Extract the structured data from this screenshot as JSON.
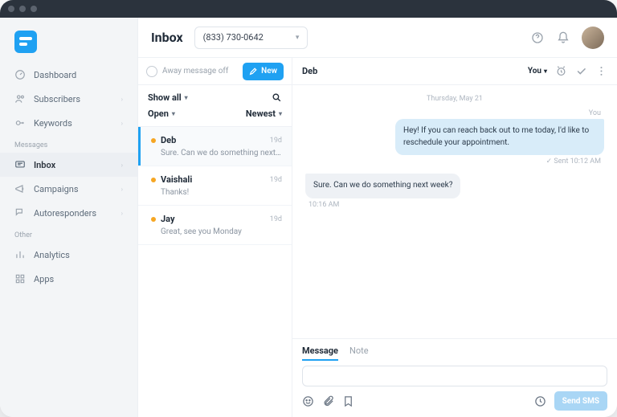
{
  "header": {
    "page_title": "Inbox",
    "phone_selected": "(833) 730-0642"
  },
  "sidebar": {
    "items": [
      {
        "label": "Dashboard"
      },
      {
        "label": "Subscribers"
      },
      {
        "label": "Keywords"
      }
    ],
    "group_messages_label": "Messages",
    "messages_items": [
      {
        "label": "Inbox"
      },
      {
        "label": "Campaigns"
      },
      {
        "label": "Autoresponders"
      }
    ],
    "group_other_label": "Other",
    "other_items": [
      {
        "label": "Analytics"
      },
      {
        "label": "Apps"
      }
    ]
  },
  "list_pane": {
    "away_label": "Away message off",
    "new_label": "New",
    "filter_show": "Show all",
    "filter_status": "Open",
    "filter_sort": "Newest"
  },
  "conversations": [
    {
      "name": "Deb",
      "time": "19d",
      "preview": "Sure. Can we do something next…"
    },
    {
      "name": "Vaishali",
      "time": "19d",
      "preview": "Thanks!"
    },
    {
      "name": "Jay",
      "time": "19d",
      "preview": "Great, see you Monday"
    }
  ],
  "conv": {
    "title": "Deb",
    "assigned_label": "You",
    "date_separator": "Thursday, May 21",
    "sender_you": "You",
    "msg_out": "Hey! If you can reach back out to me today, I'd like to reschedule your appointment.",
    "sent_stamp": "Sent 10:12 AM",
    "msg_in": "Sure. Can we do something next week?",
    "in_stamp": "10:16 AM"
  },
  "composer": {
    "tab_message": "Message",
    "tab_note": "Note",
    "placeholder": "",
    "send_label": "Send SMS"
  },
  "icons": {
    "dashboard": "dashboard-icon",
    "subscribers": "subscribers-icon",
    "keywords": "keywords-icon",
    "inbox": "inbox-icon",
    "campaigns": "campaigns-icon",
    "autoresponders": "autoresponders-icon",
    "analytics": "analytics-icon",
    "apps": "apps-icon"
  }
}
